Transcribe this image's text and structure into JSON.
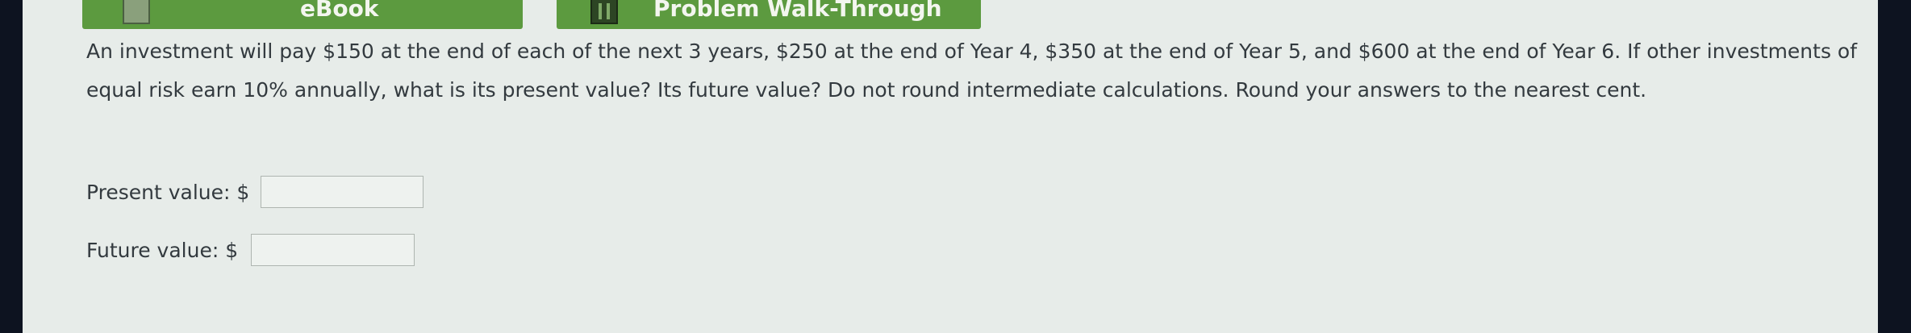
{
  "buttons": {
    "ebook": {
      "label": "eBook",
      "icon": "book-icon"
    },
    "walkthrough": {
      "label": "Problem Walk-Through",
      "icon": "film-icon"
    }
  },
  "question": "An investment will pay $150 at the end of each of the next 3 years, $250 at the end of Year 4, $350 at the end of Year 5, and $600 at the end of Year 6. If other investments of equal risk earn 10% annually, what is its present value? Its future value? Do not round intermediate calculations. Round your answers to the nearest cent.",
  "fields": {
    "present_value": {
      "label": "Present value: $",
      "value": ""
    },
    "future_value": {
      "label": "Future value: $",
      "value": ""
    }
  },
  "colors": {
    "button_green": "#5c9a3f",
    "background": "#e7ece9",
    "text": "#333a3f"
  }
}
